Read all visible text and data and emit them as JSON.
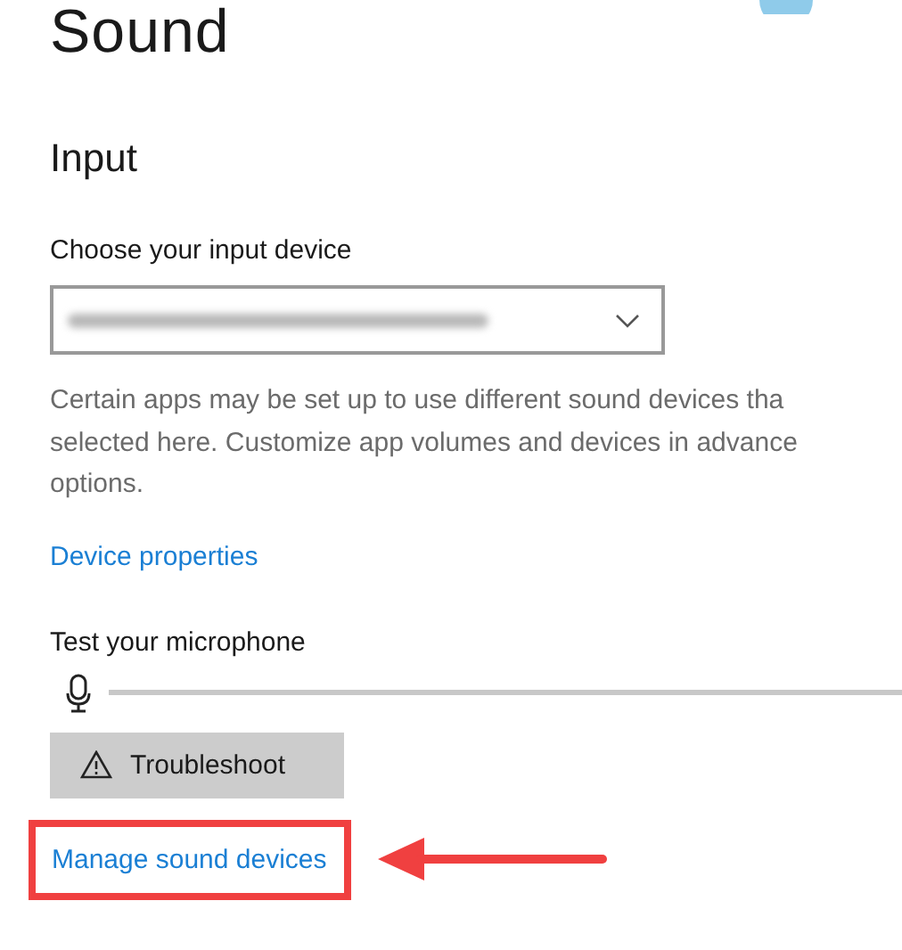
{
  "page": {
    "title": "Sound"
  },
  "input": {
    "heading": "Input",
    "device_label": "Choose your input device",
    "description_lines": [
      "Certain apps may be set up to use different sound devices tha",
      "selected here. Customize app volumes and devices in advance",
      "options."
    ],
    "device_properties_link": "Device properties",
    "test_label": "Test your microphone",
    "mic_level": {
      "level": 0
    },
    "troubleshoot_button": "Troubleshoot",
    "manage_link": {
      "label": "Manage sound devices",
      "highlighted": true
    }
  }
}
